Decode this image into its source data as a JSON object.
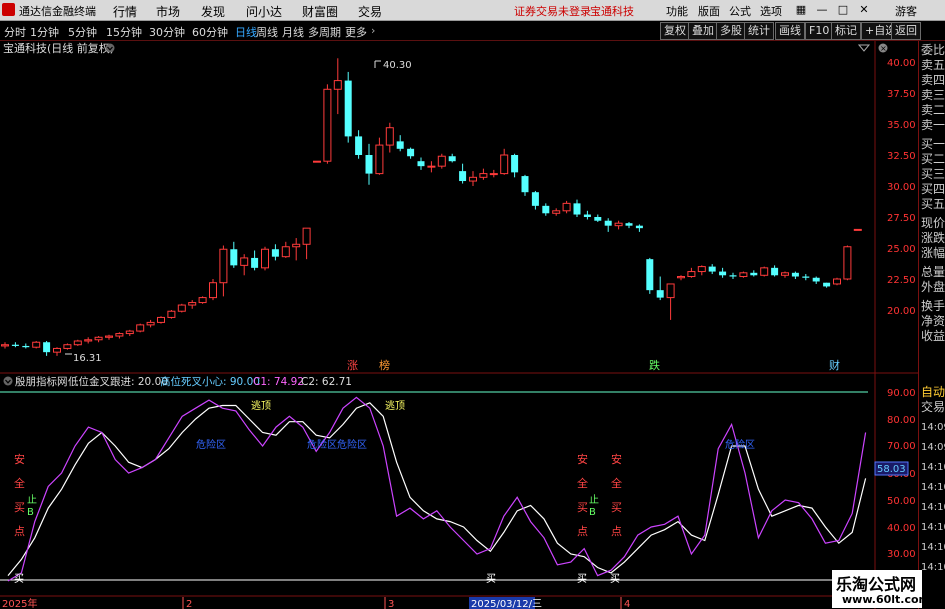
{
  "topbar": {
    "app_name": "通达信金融终端",
    "menus": [
      "行情",
      "市场",
      "发现",
      "问小达",
      "财富圈",
      "交易"
    ],
    "warning": "证券交易未登录",
    "stock": "宝通科技",
    "right_menus": [
      "功能",
      "版面",
      "公式",
      "选项"
    ],
    "guest": "游客"
  },
  "timeframes": [
    "分时",
    "1分钟",
    "5分钟",
    "15分钟",
    "30分钟",
    "60分钟",
    "日线",
    "周线",
    "月线",
    "多周期",
    "更多"
  ],
  "active_timeframe": "日线",
  "toolbar_buttons": [
    "复权",
    "叠加",
    "多股",
    "统计",
    "画线",
    "F10",
    "标记",
    "+自选",
    "返回"
  ],
  "chart_title": "宝通科技(日线 前复权)",
  "price_axis": [
    "40.00",
    "37.50",
    "35.00",
    "32.50",
    "30.00",
    "27.50",
    "25.00",
    "22.50",
    "20.00"
  ],
  "annotations": {
    "high": "40.30",
    "low": "16.31",
    "tag_zhang": "涨",
    "tag_bang": "榜",
    "tag_die": "跌",
    "tag_cai": "财"
  },
  "indicator": {
    "name": "殷朋指标网",
    "param1_label": "低位金叉跟进: 20.00",
    "param2_label": "高位死叉小心: 90.00",
    "c1_label": "C1: 74.92",
    "c2_label": "C2: 62.71",
    "axis": [
      "90.00",
      "80.00",
      "70.00",
      "60.00",
      "50.00",
      "40.00",
      "30.00"
    ],
    "current_value": "58.03",
    "escape_top": "逃顶",
    "danger_zone": "危险区",
    "danger_zone_long": "危险区危险区",
    "safe_chars": [
      "安",
      "全",
      "买",
      "点"
    ],
    "stop_b": [
      "止",
      "B"
    ],
    "buy": "买"
  },
  "time_axis": {
    "year_label": "2025年",
    "months": [
      "2",
      "3",
      "4"
    ],
    "cursor_date": "2025/03/12/三"
  },
  "right_panel": [
    {
      "label": "委比",
      "color": "#cccccc"
    },
    {
      "label": "卖五",
      "color": "#cccccc"
    },
    {
      "label": "卖四",
      "color": "#cccccc"
    },
    {
      "label": "卖三",
      "color": "#cccccc"
    },
    {
      "label": "卖二",
      "color": "#cccccc"
    },
    {
      "label": "卖一",
      "color": "#cccccc"
    },
    {
      "label": "买一",
      "color": "#cccccc"
    },
    {
      "label": "买二",
      "color": "#cccccc"
    },
    {
      "label": "买三",
      "color": "#cccccc"
    },
    {
      "label": "买四",
      "color": "#cccccc"
    },
    {
      "label": "买五",
      "color": "#cccccc"
    },
    {
      "label": "现价",
      "color": "#cccccc"
    },
    {
      "label": "涨跌",
      "color": "#cccccc"
    },
    {
      "label": "涨幅",
      "color": "#cccccc"
    },
    {
      "label": "总量",
      "color": "#cccccc"
    },
    {
      "label": "外盘",
      "color": "#cccccc"
    },
    {
      "label": "换手",
      "color": "#cccccc"
    },
    {
      "label": "净资",
      "color": "#cccccc"
    },
    {
      "label": "收益",
      "color": "#cccccc"
    }
  ],
  "right_panel_lower": {
    "title1": "自动",
    "title2": "交易",
    "times": [
      "14:09",
      "14:09",
      "14:10",
      "14:10",
      "14:10",
      "14:10",
      "14:10",
      "14:10",
      "14:10"
    ]
  },
  "price_candles": [
    [
      17.1,
      17.4,
      16.9,
      17.2
    ],
    [
      17.2,
      17.4,
      17.0,
      17.1
    ],
    [
      17.1,
      17.3,
      16.9,
      17.0
    ],
    [
      17.0,
      17.5,
      16.9,
      17.4
    ],
    [
      17.4,
      17.5,
      16.3,
      16.6
    ],
    [
      16.6,
      17.0,
      16.3,
      16.9
    ],
    [
      16.9,
      17.3,
      16.8,
      17.2
    ],
    [
      17.2,
      17.6,
      17.1,
      17.5
    ],
    [
      17.5,
      17.8,
      17.3,
      17.6
    ],
    [
      17.6,
      17.9,
      17.4,
      17.8
    ],
    [
      17.8,
      18.0,
      17.6,
      17.9
    ],
    [
      17.9,
      18.2,
      17.7,
      18.1
    ],
    [
      18.1,
      18.4,
      17.9,
      18.3
    ],
    [
      18.3,
      18.9,
      18.2,
      18.8
    ],
    [
      18.8,
      19.2,
      18.6,
      19.0
    ],
    [
      19.0,
      19.5,
      18.9,
      19.4
    ],
    [
      19.4,
      20.0,
      19.3,
      19.9
    ],
    [
      19.9,
      20.5,
      19.8,
      20.4
    ],
    [
      20.4,
      20.8,
      20.1,
      20.6
    ],
    [
      20.6,
      21.1,
      20.5,
      21.0
    ],
    [
      21.0,
      22.5,
      20.8,
      22.2
    ],
    [
      22.2,
      25.2,
      21.1,
      24.9
    ],
    [
      24.9,
      25.5,
      23.4,
      23.6
    ],
    [
      23.6,
      24.5,
      22.8,
      24.2
    ],
    [
      24.2,
      24.8,
      23.2,
      23.4
    ],
    [
      23.4,
      25.1,
      23.2,
      24.9
    ],
    [
      24.9,
      25.3,
      24.0,
      24.3
    ],
    [
      24.3,
      25.5,
      24.2,
      25.1
    ],
    [
      25.1,
      25.8,
      24.0,
      25.3
    ],
    [
      25.3,
      26.4,
      24.1,
      26.6
    ],
    [
      32.0,
      32.0,
      32.0,
      32.0
    ],
    [
      32.0,
      38.2,
      31.8,
      37.8
    ],
    [
      37.8,
      40.3,
      35.8,
      38.5
    ],
    [
      38.5,
      39.2,
      33.5,
      34.0
    ],
    [
      34.0,
      34.5,
      32.2,
      32.5
    ],
    [
      32.5,
      33.4,
      30.1,
      31.0
    ],
    [
      31.0,
      33.9,
      30.9,
      33.3
    ],
    [
      33.3,
      35.1,
      32.7,
      34.7
    ],
    [
      33.6,
      34.1,
      32.8,
      33.0
    ],
    [
      33.0,
      33.1,
      32.2,
      32.4
    ],
    [
      32.0,
      32.3,
      31.3,
      31.6
    ],
    [
      31.6,
      32.0,
      31.1,
      31.6
    ],
    [
      31.6,
      32.6,
      31.4,
      32.4
    ],
    [
      32.4,
      32.6,
      31.9,
      32.0
    ],
    [
      31.2,
      31.8,
      30.2,
      30.4
    ],
    [
      30.4,
      31.2,
      30.0,
      30.7
    ],
    [
      30.7,
      31.4,
      30.5,
      31.0
    ],
    [
      31.0,
      31.3,
      30.7,
      31.0
    ],
    [
      31.0,
      33.0,
      30.9,
      32.5
    ],
    [
      32.5,
      32.6,
      30.7,
      31.1
    ],
    [
      30.8,
      30.9,
      29.2,
      29.5
    ],
    [
      29.5,
      29.6,
      28.1,
      28.4
    ],
    [
      28.4,
      28.6,
      27.6,
      27.8
    ],
    [
      27.8,
      28.2,
      27.6,
      28.0
    ],
    [
      28.0,
      28.8,
      27.8,
      28.6
    ],
    [
      28.6,
      28.9,
      27.5,
      27.7
    ],
    [
      27.7,
      28.0,
      27.3,
      27.5
    ],
    [
      27.5,
      27.7,
      27.1,
      27.2
    ],
    [
      27.2,
      27.4,
      26.3,
      26.8
    ],
    [
      26.8,
      27.2,
      26.5,
      27.0
    ],
    [
      27.0,
      27.1,
      26.6,
      26.8
    ],
    [
      26.8,
      26.9,
      26.3,
      26.6
    ],
    [
      24.1,
      24.2,
      21.3,
      21.6
    ],
    [
      21.6,
      22.7,
      20.8,
      21.0
    ],
    [
      21.0,
      22.1,
      19.2,
      22.1
    ],
    [
      22.6,
      22.8,
      22.4,
      22.7
    ],
    [
      22.7,
      23.4,
      22.6,
      23.1
    ],
    [
      23.1,
      23.6,
      22.8,
      23.5
    ],
    [
      23.5,
      23.7,
      22.9,
      23.1
    ],
    [
      23.1,
      23.4,
      22.6,
      22.8
    ],
    [
      22.8,
      23.0,
      22.5,
      22.7
    ],
    [
      22.7,
      23.1,
      22.6,
      23.0
    ],
    [
      23.0,
      23.2,
      22.7,
      22.8
    ],
    [
      22.8,
      23.5,
      22.7,
      23.4
    ],
    [
      23.4,
      23.6,
      22.7,
      22.8
    ],
    [
      22.8,
      23.1,
      22.6,
      23.0
    ],
    [
      23.0,
      23.1,
      22.5,
      22.7
    ],
    [
      22.7,
      22.9,
      22.4,
      22.6
    ],
    [
      22.6,
      22.7,
      22.1,
      22.3
    ],
    [
      22.2,
      22.2,
      21.8,
      21.9
    ],
    [
      22.1,
      22.6,
      22.0,
      22.5
    ],
    [
      22.5,
      25.2,
      22.4,
      25.1
    ],
    [
      26.5,
      26.5,
      26.5,
      26.5
    ]
  ],
  "c1_series": [
    20,
    23,
    42,
    55,
    60,
    70,
    77,
    75,
    65,
    60,
    62,
    65,
    73,
    81,
    84,
    87,
    84,
    83,
    76,
    70,
    77,
    81,
    77,
    68,
    75,
    84,
    88,
    84,
    70,
    44,
    47,
    43,
    46,
    40,
    35,
    30,
    32,
    44,
    51,
    42,
    36,
    26,
    27,
    32,
    22,
    24,
    29,
    37,
    40,
    41,
    44,
    30,
    37,
    69,
    78,
    60,
    36,
    46,
    50,
    49,
    43,
    34,
    35,
    45,
    75
  ],
  "c2_series": [
    22,
    28,
    36,
    47,
    54,
    63,
    71,
    75,
    70,
    64,
    62,
    65,
    69,
    75,
    80,
    84,
    85,
    85,
    80,
    75,
    74,
    79,
    79,
    74,
    73,
    78,
    84,
    86,
    81,
    64,
    51,
    46,
    43,
    42,
    40,
    35,
    31,
    38,
    46,
    48,
    43,
    34,
    30,
    29,
    25,
    23,
    27,
    32,
    37,
    39,
    42,
    37,
    35,
    52,
    70,
    70,
    54,
    44,
    46,
    48,
    47,
    40,
    34,
    38,
    58
  ]
}
